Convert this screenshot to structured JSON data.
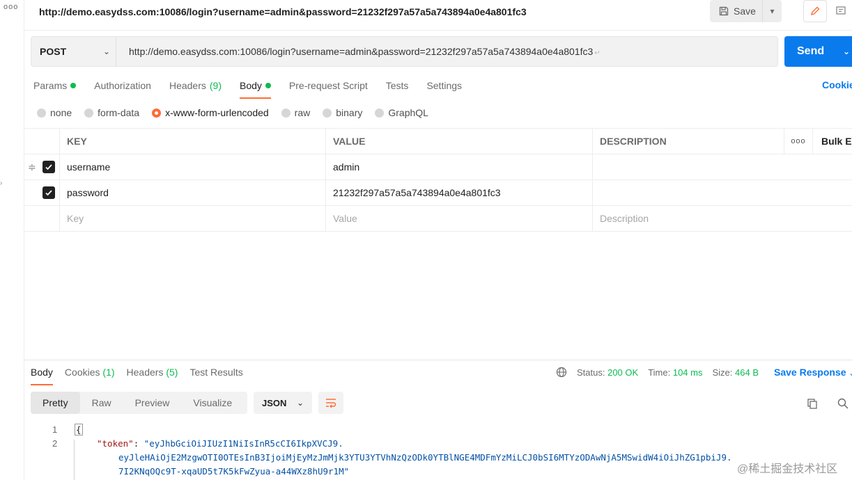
{
  "rail": {
    "dots": "ooo"
  },
  "title_bar": {
    "request_title": "http://demo.easydss.com:10086/login?username=admin&password=21232f297a57a5a743894a0e4a801fc3",
    "save_label": "Save"
  },
  "request": {
    "method": "POST",
    "url": "http://demo.easydss.com:10086/login?username=admin&password=21232f297a57a5a743894a0e4a801fc3",
    "send_label": "Send"
  },
  "req_tabs": [
    {
      "label": "Params",
      "dot": true
    },
    {
      "label": "Authorization"
    },
    {
      "label": "Headers",
      "count": "(9)"
    },
    {
      "label": "Body",
      "dot": true,
      "active": true
    },
    {
      "label": "Pre-request Script"
    },
    {
      "label": "Tests"
    },
    {
      "label": "Settings"
    }
  ],
  "cookies_link": "Cookie",
  "body_types": [
    "none",
    "form-data",
    "x-www-form-urlencoded",
    "raw",
    "binary",
    "GraphQL"
  ],
  "body_type_selected": "x-www-form-urlencoded",
  "params_table": {
    "headers": {
      "key": "KEY",
      "value": "VALUE",
      "description": "DESCRIPTION",
      "more": "ooo",
      "bulk": "Bulk Ed"
    },
    "rows": [
      {
        "key": "username",
        "value": "admin",
        "checked": true
      },
      {
        "key": "password",
        "value": "21232f297a57a5a743894a0e4a801fc3",
        "checked": true
      }
    ],
    "placeholder": {
      "key": "Key",
      "value": "Value",
      "description": "Description"
    }
  },
  "response": {
    "tabs": [
      {
        "label": "Body",
        "active": true
      },
      {
        "label": "Cookies",
        "count": "(1)"
      },
      {
        "label": "Headers",
        "count": "(5)"
      },
      {
        "label": "Test Results"
      }
    ],
    "status_label": "Status:",
    "status_value": "200 OK",
    "time_label": "Time:",
    "time_value": "104 ms",
    "size_label": "Size:",
    "size_value": "464 B",
    "save_response": "Save Response",
    "views": [
      "Pretty",
      "Raw",
      "Preview",
      "Visualize"
    ],
    "format": "JSON",
    "code": {
      "line1": "1",
      "line2": "2",
      "open_brace": "{",
      "key": "\"token\"",
      "sep": ": ",
      "value_1": "\"eyJhbGciOiJIUzI1NiIsInR5cCI6IkpXVCJ9.",
      "value_2": "eyJleHAiOjE2MzgwOTI0OTEsInB3IjoiMjEyMzJmMjk3YTU3YTVhNzQzODk0YTBlNGE4MDFmYzMiLCJ0bSI6MTYzODAwNjA5MSwidW4iOiJhZG1pbiJ9.",
      "value_3": "7I2KNqOQc9T-xqaUD5t7K5kFwZyua-a44WXz8hU9r1M\""
    }
  },
  "watermark": "@稀土掘金技术社区",
  "colors": {
    "accent": "#ff6c37",
    "primary": "#097bed",
    "success": "#0cbb52"
  }
}
